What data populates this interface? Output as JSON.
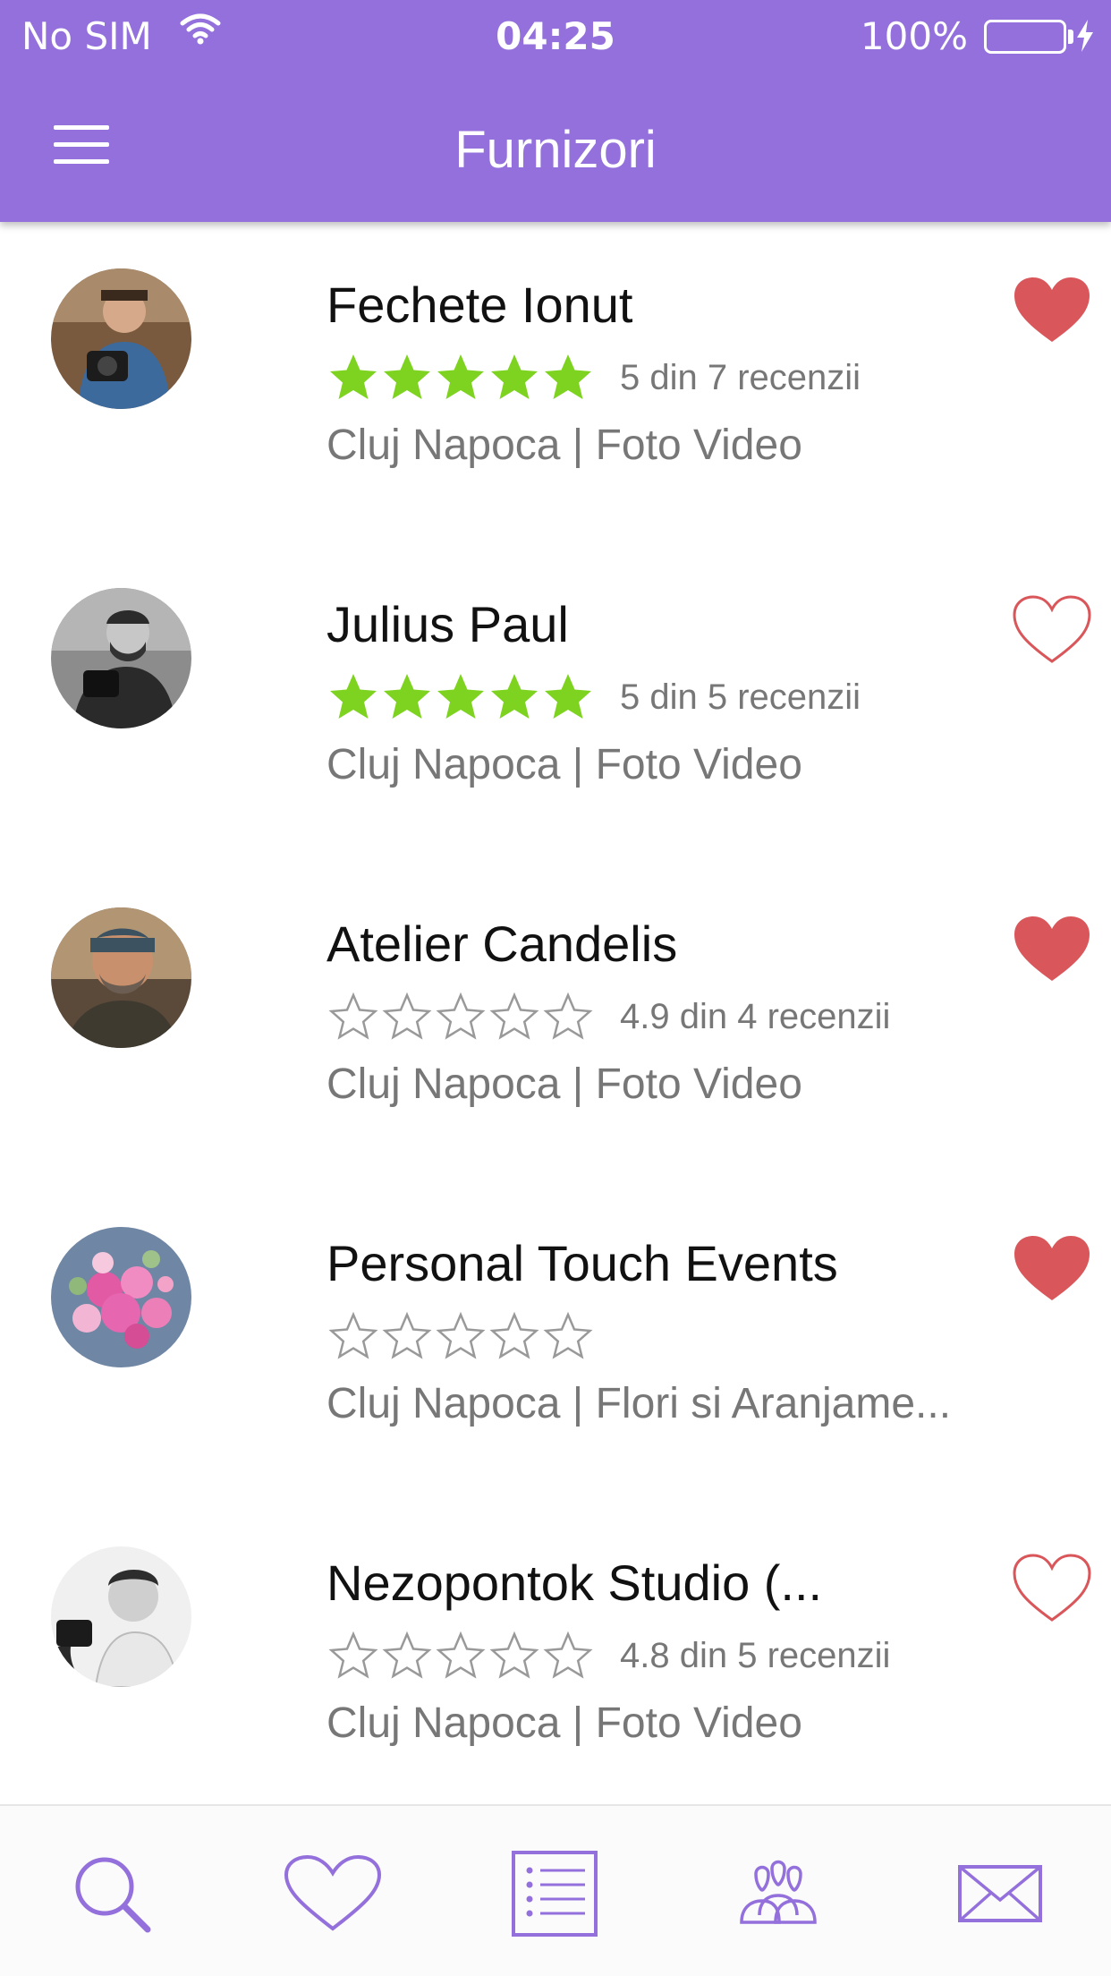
{
  "status_bar": {
    "carrier": "No SIM",
    "time": "04:25",
    "battery": "100%",
    "wifi_icon": "wifi-icon",
    "charging_icon": "bolt-icon"
  },
  "header": {
    "title": "Furnizori",
    "menu_icon": "hamburger-icon",
    "background": "#9370db"
  },
  "colors": {
    "accent": "#9370db",
    "star_filled": "#7ed321",
    "star_empty": "#999999",
    "heart": "#d9575b"
  },
  "providers": [
    {
      "name": "Fechete Ionut",
      "rating": 5,
      "rating_text": "5 din 7 recenzii",
      "meta": "Cluj Napoca | Foto Video",
      "favorite": true,
      "stars_filled": true
    },
    {
      "name": "Julius Paul",
      "rating": 5,
      "rating_text": "5 din 5 recenzii",
      "meta": "Cluj Napoca | Foto Video",
      "favorite": false,
      "stars_filled": true
    },
    {
      "name": "Atelier Candelis",
      "rating": 0,
      "rating_text": "4.9 din 4 recenzii",
      "meta": "Cluj Napoca | Foto Video",
      "favorite": true,
      "stars_filled": false
    },
    {
      "name": "Personal Touch Events",
      "rating": 0,
      "rating_text": "",
      "meta": "Cluj Napoca | Flori si Aranjame...",
      "favorite": true,
      "stars_filled": false
    },
    {
      "name": "Nezopontok Studio (...",
      "rating": 0,
      "rating_text": "4.8 din 5 recenzii",
      "meta": "Cluj Napoca | Foto Video",
      "favorite": false,
      "stars_filled": false
    }
  ],
  "tabbar": {
    "tabs": [
      {
        "icon": "search-icon"
      },
      {
        "icon": "heart-icon"
      },
      {
        "icon": "list-icon"
      },
      {
        "icon": "group-icon"
      },
      {
        "icon": "mail-icon"
      }
    ]
  }
}
